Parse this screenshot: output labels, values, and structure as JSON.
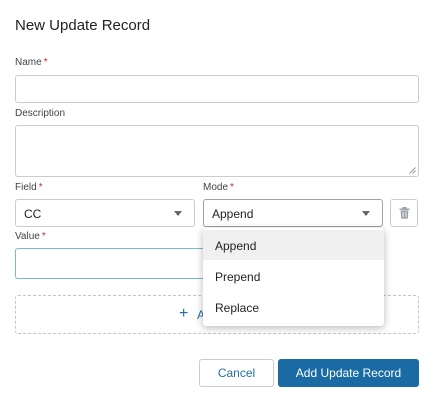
{
  "dialog": {
    "title": "New Update Record"
  },
  "form": {
    "name": {
      "label": "Name",
      "required_mark": "*",
      "value": ""
    },
    "description": {
      "label": "Description",
      "value": ""
    },
    "field": {
      "label": "Field",
      "required_mark": "*",
      "selected": "CC"
    },
    "mode": {
      "label": "Mode",
      "required_mark": "*",
      "selected": "Append"
    },
    "value": {
      "label": "Value",
      "required_mark": "*",
      "value": ""
    }
  },
  "mode_dropdown": {
    "options": [
      "Append",
      "Prepend",
      "Replace"
    ],
    "selected_index": 0
  },
  "add_row": {
    "plus": "+",
    "label": "A"
  },
  "buttons": {
    "cancel": "Cancel",
    "submit": "Add Update Record"
  },
  "colors": {
    "accent": "#1a6aa3",
    "link": "#1f6fa6",
    "required": "#d9262b"
  }
}
